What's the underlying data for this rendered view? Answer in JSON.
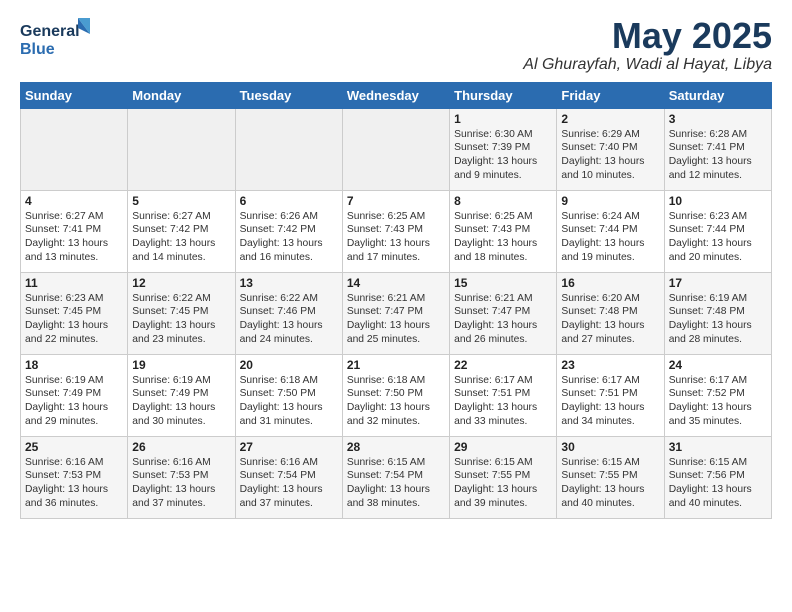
{
  "logo": {
    "line1": "General",
    "line2": "Blue"
  },
  "title": "May 2025",
  "subtitle": "Al Ghurayfah, Wadi al Hayat, Libya",
  "days_of_week": [
    "Sunday",
    "Monday",
    "Tuesday",
    "Wednesday",
    "Thursday",
    "Friday",
    "Saturday"
  ],
  "weeks": [
    [
      {
        "num": "",
        "info": ""
      },
      {
        "num": "",
        "info": ""
      },
      {
        "num": "",
        "info": ""
      },
      {
        "num": "",
        "info": ""
      },
      {
        "num": "1",
        "info": "Sunrise: 6:30 AM\nSunset: 7:39 PM\nDaylight: 13 hours\nand 9 minutes."
      },
      {
        "num": "2",
        "info": "Sunrise: 6:29 AM\nSunset: 7:40 PM\nDaylight: 13 hours\nand 10 minutes."
      },
      {
        "num": "3",
        "info": "Sunrise: 6:28 AM\nSunset: 7:41 PM\nDaylight: 13 hours\nand 12 minutes."
      }
    ],
    [
      {
        "num": "4",
        "info": "Sunrise: 6:27 AM\nSunset: 7:41 PM\nDaylight: 13 hours\nand 13 minutes."
      },
      {
        "num": "5",
        "info": "Sunrise: 6:27 AM\nSunset: 7:42 PM\nDaylight: 13 hours\nand 14 minutes."
      },
      {
        "num": "6",
        "info": "Sunrise: 6:26 AM\nSunset: 7:42 PM\nDaylight: 13 hours\nand 16 minutes."
      },
      {
        "num": "7",
        "info": "Sunrise: 6:25 AM\nSunset: 7:43 PM\nDaylight: 13 hours\nand 17 minutes."
      },
      {
        "num": "8",
        "info": "Sunrise: 6:25 AM\nSunset: 7:43 PM\nDaylight: 13 hours\nand 18 minutes."
      },
      {
        "num": "9",
        "info": "Sunrise: 6:24 AM\nSunset: 7:44 PM\nDaylight: 13 hours\nand 19 minutes."
      },
      {
        "num": "10",
        "info": "Sunrise: 6:23 AM\nSunset: 7:44 PM\nDaylight: 13 hours\nand 20 minutes."
      }
    ],
    [
      {
        "num": "11",
        "info": "Sunrise: 6:23 AM\nSunset: 7:45 PM\nDaylight: 13 hours\nand 22 minutes."
      },
      {
        "num": "12",
        "info": "Sunrise: 6:22 AM\nSunset: 7:45 PM\nDaylight: 13 hours\nand 23 minutes."
      },
      {
        "num": "13",
        "info": "Sunrise: 6:22 AM\nSunset: 7:46 PM\nDaylight: 13 hours\nand 24 minutes."
      },
      {
        "num": "14",
        "info": "Sunrise: 6:21 AM\nSunset: 7:47 PM\nDaylight: 13 hours\nand 25 minutes."
      },
      {
        "num": "15",
        "info": "Sunrise: 6:21 AM\nSunset: 7:47 PM\nDaylight: 13 hours\nand 26 minutes."
      },
      {
        "num": "16",
        "info": "Sunrise: 6:20 AM\nSunset: 7:48 PM\nDaylight: 13 hours\nand 27 minutes."
      },
      {
        "num": "17",
        "info": "Sunrise: 6:19 AM\nSunset: 7:48 PM\nDaylight: 13 hours\nand 28 minutes."
      }
    ],
    [
      {
        "num": "18",
        "info": "Sunrise: 6:19 AM\nSunset: 7:49 PM\nDaylight: 13 hours\nand 29 minutes."
      },
      {
        "num": "19",
        "info": "Sunrise: 6:19 AM\nSunset: 7:49 PM\nDaylight: 13 hours\nand 30 minutes."
      },
      {
        "num": "20",
        "info": "Sunrise: 6:18 AM\nSunset: 7:50 PM\nDaylight: 13 hours\nand 31 minutes."
      },
      {
        "num": "21",
        "info": "Sunrise: 6:18 AM\nSunset: 7:50 PM\nDaylight: 13 hours\nand 32 minutes."
      },
      {
        "num": "22",
        "info": "Sunrise: 6:17 AM\nSunset: 7:51 PM\nDaylight: 13 hours\nand 33 minutes."
      },
      {
        "num": "23",
        "info": "Sunrise: 6:17 AM\nSunset: 7:51 PM\nDaylight: 13 hours\nand 34 minutes."
      },
      {
        "num": "24",
        "info": "Sunrise: 6:17 AM\nSunset: 7:52 PM\nDaylight: 13 hours\nand 35 minutes."
      }
    ],
    [
      {
        "num": "25",
        "info": "Sunrise: 6:16 AM\nSunset: 7:53 PM\nDaylight: 13 hours\nand 36 minutes."
      },
      {
        "num": "26",
        "info": "Sunrise: 6:16 AM\nSunset: 7:53 PM\nDaylight: 13 hours\nand 37 minutes."
      },
      {
        "num": "27",
        "info": "Sunrise: 6:16 AM\nSunset: 7:54 PM\nDaylight: 13 hours\nand 37 minutes."
      },
      {
        "num": "28",
        "info": "Sunrise: 6:15 AM\nSunset: 7:54 PM\nDaylight: 13 hours\nand 38 minutes."
      },
      {
        "num": "29",
        "info": "Sunrise: 6:15 AM\nSunset: 7:55 PM\nDaylight: 13 hours\nand 39 minutes."
      },
      {
        "num": "30",
        "info": "Sunrise: 6:15 AM\nSunset: 7:55 PM\nDaylight: 13 hours\nand 40 minutes."
      },
      {
        "num": "31",
        "info": "Sunrise: 6:15 AM\nSunset: 7:56 PM\nDaylight: 13 hours\nand 40 minutes."
      }
    ]
  ]
}
